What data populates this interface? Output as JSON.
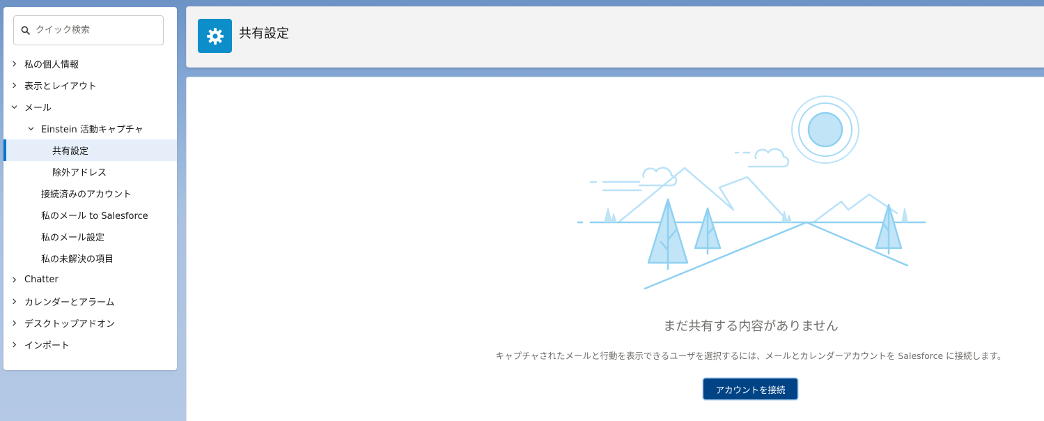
{
  "search": {
    "placeholder": "クイック検索"
  },
  "sidebar": {
    "items": [
      {
        "label": "私の個人情報",
        "level": 0,
        "chevron": "right"
      },
      {
        "label": "表示とレイアウト",
        "level": 0,
        "chevron": "right"
      },
      {
        "label": "メール",
        "level": 0,
        "chevron": "down"
      },
      {
        "label": "Einstein 活動キャプチャ",
        "level": 1,
        "chevron": "down"
      },
      {
        "label": "共有設定",
        "level": 2,
        "chevron": "",
        "active": true
      },
      {
        "label": "除外アドレス",
        "level": 2,
        "chevron": ""
      },
      {
        "label": "接続済みのアカウント",
        "level": 1,
        "chevron": ""
      },
      {
        "label": "私のメール to Salesforce",
        "level": 1,
        "chevron": ""
      },
      {
        "label": "私のメール設定",
        "level": 1,
        "chevron": ""
      },
      {
        "label": "私の未解決の項目",
        "level": 1,
        "chevron": ""
      },
      {
        "label": "Chatter",
        "level": 0,
        "chevron": "right"
      },
      {
        "label": "カレンダーとアラーム",
        "level": 0,
        "chevron": "right"
      },
      {
        "label": "デスクトップアドオン",
        "level": 0,
        "chevron": "right"
      },
      {
        "label": "インポート",
        "level": 0,
        "chevron": "right"
      }
    ]
  },
  "header": {
    "title": "共有設定",
    "icon": "gear-icon"
  },
  "main": {
    "empty_title": "まだ共有する内容がありません",
    "empty_description": "キャプチャされたメールと行動を表示できるユーザを選択するには、メールとカレンダーアカウントを Salesforce に接続します。",
    "connect_button": "アカウントを接続"
  },
  "colors": {
    "accent": "#0176d3",
    "button_bg": "#014486",
    "header_icon_bg": "#0c8eca",
    "illustration_line": "#8fd1f2",
    "illustration_fill": "#c1e4f7"
  }
}
